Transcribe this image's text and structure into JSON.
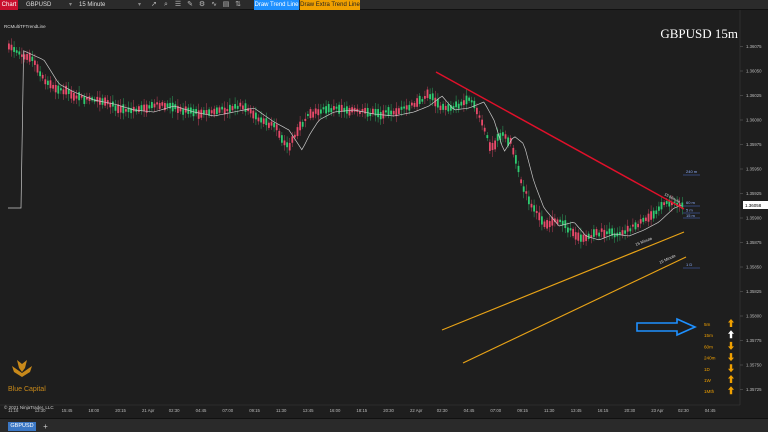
{
  "toolbar": {
    "chart_label": "Chart",
    "instrument": "GBPUSD",
    "interval": "15 Minute",
    "draw_trend_line": "Draw Trend Line",
    "draw_extra_trend_line": "Draw Extra Trend Line",
    "icons": [
      "cursor-icon",
      "zoom-icon",
      "properties-icon",
      "drawing-tools-icon",
      "strategy-icon",
      "indicator-icon",
      "templates-icon",
      "chart-trader-icon"
    ]
  },
  "chart": {
    "indicator_label": "RCMultiTFTrendLine",
    "symbol_tf": "GBPUSD 15m",
    "copyright": "© 2021 NinjaTrader, LLC",
    "watermark": "Blue Capital",
    "y_ticks": [
      "1.36075",
      "1.36050",
      "1.36025",
      "1.36000",
      "1.35975",
      "1.35950",
      "1.35925",
      "1.35900",
      "1.35875",
      "1.35850",
      "1.35825",
      "1.35800",
      "1.35775",
      "1.35750",
      "1.35725",
      "1.35700"
    ],
    "current_price": "1.36058",
    "x_ticks": [
      "11:15",
      "13:30",
      "15:45",
      "18:00",
      "20:15",
      "21 Apr",
      "02:30",
      "04:45",
      "07:00",
      "09:15",
      "11:30",
      "13:45",
      "16:00",
      "18:15",
      "20:30",
      "22 Apr",
      "02:30",
      "04:45",
      "07:00",
      "09:15",
      "11:30",
      "13:45",
      "16:15",
      "20:30",
      "23 Apr",
      "02:30",
      "04:45"
    ],
    "line_labels": {
      "red_line": "15 Minute",
      "orange_top": "15 Minute",
      "orange_bottom": "15 Minute"
    },
    "right_small_labels": [
      "240 m",
      "60 m",
      "5 m",
      "15 m",
      "1 D"
    ],
    "timeframes": [
      {
        "label": "5m",
        "direction": "up",
        "highlight": false
      },
      {
        "label": "15m",
        "direction": "up",
        "highlight": true
      },
      {
        "label": "60m",
        "direction": "down",
        "highlight": false
      },
      {
        "label": "240m",
        "direction": "down",
        "highlight": false
      },
      {
        "label": "1D",
        "direction": "down",
        "highlight": false
      },
      {
        "label": "1W",
        "direction": "up",
        "highlight": false
      },
      {
        "label": "1Mth",
        "direction": "up",
        "highlight": false
      }
    ],
    "colors": {
      "up_candle": "#2ecc71",
      "down_candle": "#e84a6a",
      "red_trend": "#e0102a",
      "orange_trend": "#e8a317",
      "sma": "#c8c8c8",
      "arrow_up": "#f0a000",
      "arrow_highlight": "#ffffff",
      "pointer_arrow": "#1e90ff",
      "current_price_bg": "#ffffff"
    }
  },
  "tabs": [
    {
      "label": "GBPUSD"
    }
  ]
}
